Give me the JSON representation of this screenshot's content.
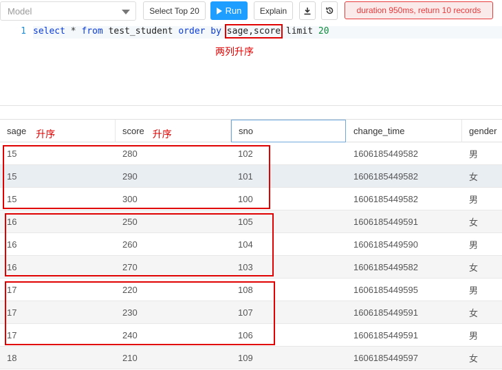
{
  "toolbar": {
    "model_placeholder": "Model",
    "select_top_label": "Select Top 20",
    "run_label": "Run",
    "explain_label": "Explain",
    "status_text": "duration 950ms, return 10 records"
  },
  "editor": {
    "line_number": "1",
    "tokens": {
      "select": "select",
      "star": " * ",
      "from": "from",
      "table": " test_student ",
      "order_by": "order by",
      "cols": "sage,score",
      "limit": " limit ",
      "limit_value": "20"
    },
    "annotation": "两列升序"
  },
  "grid": {
    "columns": [
      "sage",
      "score",
      "sno",
      "change_time",
      "gender"
    ],
    "header_annotations": {
      "sage": "升序",
      "score": "升序"
    },
    "rows": [
      [
        "15",
        "280",
        "102",
        "1606185449582",
        "男"
      ],
      [
        "15",
        "290",
        "101",
        "1606185449582",
        "女"
      ],
      [
        "15",
        "300",
        "100",
        "1606185449582",
        "男"
      ],
      [
        "16",
        "250",
        "105",
        "1606185449591",
        "女"
      ],
      [
        "16",
        "260",
        "104",
        "1606185449590",
        "男"
      ],
      [
        "16",
        "270",
        "103",
        "1606185449582",
        "女"
      ],
      [
        "17",
        "220",
        "108",
        "1606185449595",
        "男"
      ],
      [
        "17",
        "230",
        "107",
        "1606185449591",
        "女"
      ],
      [
        "17",
        "240",
        "106",
        "1606185449591",
        "男"
      ],
      [
        "18",
        "210",
        "109",
        "1606185449597",
        "女"
      ]
    ]
  },
  "colors": {
    "run_button": "#1e9fff",
    "status_text": "#e8393b",
    "annotation_red": "#e00000"
  }
}
